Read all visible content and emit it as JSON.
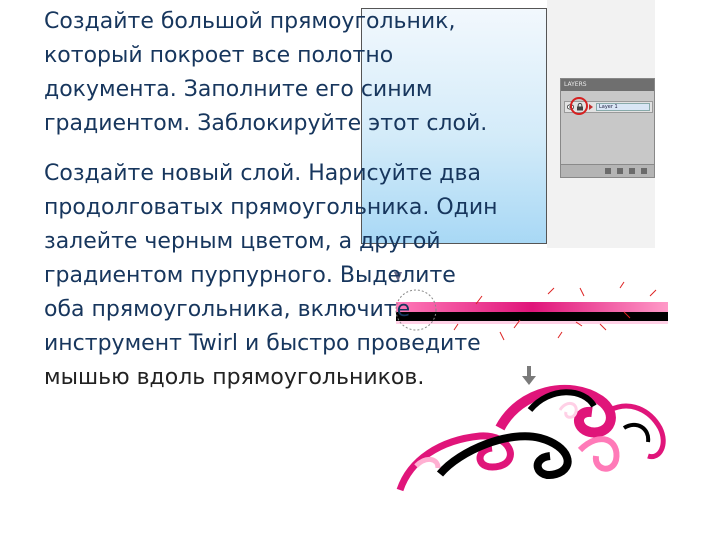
{
  "instructions": {
    "paragraph1": [
      "Создайте большой прямоугольник,",
      "который покроет все полотно",
      "документа. Заполните его синим",
      "градиентом. Заблокируйте этот слой."
    ],
    "paragraph2": [
      "Создайте новый слой. Нарисуйте два",
      "продолговатых прямоугольника. Один",
      "залейте черным цветом, а другой",
      "градиентом пурпурного. Выделите",
      "оба прямоугольника, включите",
      "инструмент Twirl и быстро проведите",
      "мышью вдоль прямоугольников."
    ]
  },
  "layers_panel": {
    "title": "LAYERS",
    "layer_name": "Layer 1"
  },
  "colors": {
    "text": "#17365d",
    "gradient_top": "#f2f8fd",
    "gradient_bottom": "#a8d8f5",
    "magenta": "#e0157a",
    "black": "#000000",
    "lock_highlight": "#d52020"
  }
}
